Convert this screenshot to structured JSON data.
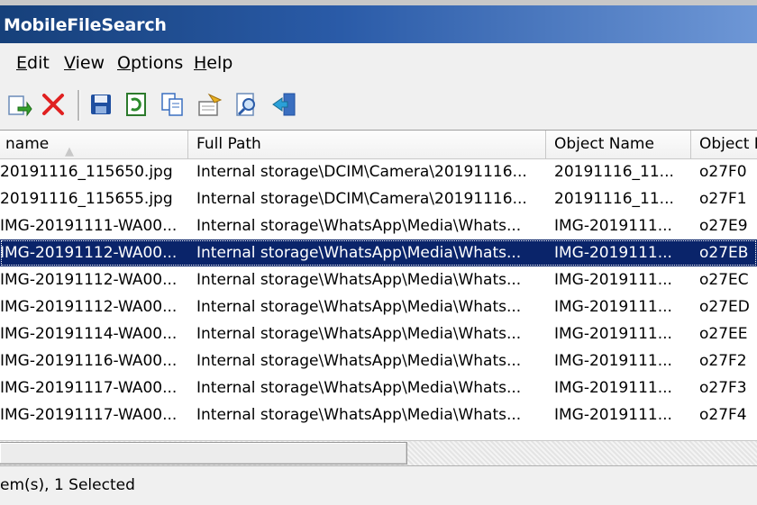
{
  "window": {
    "title": "MobileFileSearch"
  },
  "menu": [
    {
      "label": "Edit",
      "accel": "E"
    },
    {
      "label": "View",
      "accel": "V"
    },
    {
      "label": "Options",
      "accel": "O"
    },
    {
      "label": "Help",
      "accel": "H"
    }
  ],
  "toolbar": {
    "icons": [
      "refresh-icon",
      "delete-icon",
      "save-icon",
      "excel-icon",
      "copy-icon",
      "properties-icon",
      "find-icon",
      "exit-icon"
    ],
    "accent_red": "#e02020",
    "accent_blue": "#1f5fbf"
  },
  "columns": [
    "name",
    "Full Path",
    "Object Name",
    "Object I"
  ],
  "rows": [
    {
      "name": "20191116_115650.jpg",
      "path": "Internal storage\\DCIM\\Camera\\20191116...",
      "object": "20191116_11...",
      "id": "o27F0"
    },
    {
      "name": "20191116_115655.jpg",
      "path": "Internal storage\\DCIM\\Camera\\20191116...",
      "object": "20191116_11...",
      "id": "o27F1"
    },
    {
      "name": "IMG-20191111-WA00...",
      "path": "Internal storage\\WhatsApp\\Media\\Whats...",
      "object": "IMG-2019111...",
      "id": "o27E9"
    },
    {
      "name": "IMG-20191112-WA00...",
      "path": "Internal storage\\WhatsApp\\Media\\Whats...",
      "object": "IMG-2019111...",
      "id": "o27EB",
      "selected": true
    },
    {
      "name": "IMG-20191112-WA00...",
      "path": "Internal storage\\WhatsApp\\Media\\Whats...",
      "object": "IMG-2019111...",
      "id": "o27EC"
    },
    {
      "name": "IMG-20191112-WA00...",
      "path": "Internal storage\\WhatsApp\\Media\\Whats...",
      "object": "IMG-2019111...",
      "id": "o27ED"
    },
    {
      "name": "IMG-20191114-WA00...",
      "path": "Internal storage\\WhatsApp\\Media\\Whats...",
      "object": "IMG-2019111...",
      "id": "o27EE"
    },
    {
      "name": "IMG-20191116-WA00...",
      "path": "Internal storage\\WhatsApp\\Media\\Whats...",
      "object": "IMG-2019111...",
      "id": "o27F2"
    },
    {
      "name": "IMG-20191117-WA00...",
      "path": "Internal storage\\WhatsApp\\Media\\Whats...",
      "object": "IMG-2019111...",
      "id": "o27F3"
    },
    {
      "name": "IMG-20191117-WA00...",
      "path": "Internal storage\\WhatsApp\\Media\\Whats...",
      "object": "IMG-2019111...",
      "id": "o27F4"
    }
  ],
  "status": {
    "text": "em(s), 1 Selected"
  },
  "colors": {
    "title_start": "#16407a",
    "title_end": "#6e97d6",
    "selection": "#0a246a"
  }
}
